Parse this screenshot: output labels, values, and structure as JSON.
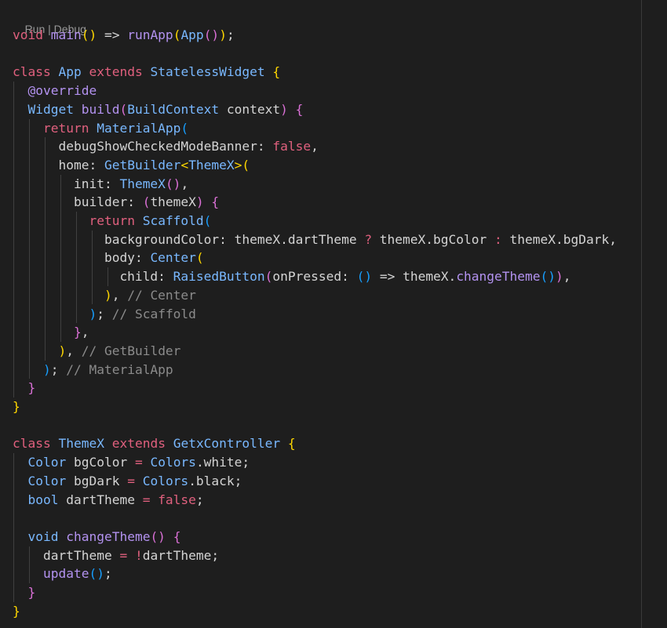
{
  "codelens": {
    "run": "Run",
    "separator": " | ",
    "debug": "Debug"
  },
  "colors": {
    "background": "#1e1e1e",
    "keyword": "#e0607e",
    "type": "#79b8ff",
    "function": "#b392f0",
    "text": "#d4d4d4",
    "comment": "#8b8b8b",
    "bracket_gold": "#ffd700",
    "bracket_orchid": "#da70d6",
    "bracket_blue": "#179fff"
  },
  "lines": [
    [
      [
        "void",
        "kw"
      ],
      [
        " ",
        "pl"
      ],
      [
        "main",
        "fn"
      ],
      [
        "()",
        "b1"
      ],
      [
        " => ",
        "op"
      ],
      [
        "runApp",
        "fn"
      ],
      [
        "(",
        "b1"
      ],
      [
        "App",
        "ty"
      ],
      [
        "()",
        "b2"
      ],
      [
        ")",
        "b1"
      ],
      [
        ";",
        "pl"
      ]
    ],
    [],
    [
      [
        "class",
        "kw"
      ],
      [
        " ",
        "pl"
      ],
      [
        "App",
        "ty"
      ],
      [
        " ",
        "pl"
      ],
      [
        "extends",
        "kw"
      ],
      [
        " ",
        "pl"
      ],
      [
        "StatelessWidget",
        "ty"
      ],
      [
        " ",
        "pl"
      ],
      [
        "{",
        "b1"
      ]
    ],
    [
      [
        "  ",
        "pl"
      ],
      [
        "@override",
        "fn"
      ]
    ],
    [
      [
        "  ",
        "pl"
      ],
      [
        "Widget",
        "ty"
      ],
      [
        " ",
        "pl"
      ],
      [
        "build",
        "fn"
      ],
      [
        "(",
        "b2"
      ],
      [
        "BuildContext",
        "ty"
      ],
      [
        " context",
        "pl"
      ],
      [
        ")",
        "b2"
      ],
      [
        " ",
        "pl"
      ],
      [
        "{",
        "b2"
      ]
    ],
    [
      [
        "    ",
        "pl"
      ],
      [
        "return",
        "kw"
      ],
      [
        " ",
        "pl"
      ],
      [
        "MaterialApp",
        "ty"
      ],
      [
        "(",
        "b3"
      ]
    ],
    [
      [
        "      debugShowCheckedModeBanner",
        "pl"
      ],
      [
        ": ",
        "pl"
      ],
      [
        "false",
        "kw"
      ],
      [
        ",",
        "pl"
      ]
    ],
    [
      [
        "      home",
        "pl"
      ],
      [
        ": ",
        "pl"
      ],
      [
        "GetBuilder",
        "ty"
      ],
      [
        "<",
        "b1"
      ],
      [
        "ThemeX",
        "ty"
      ],
      [
        ">",
        "b1"
      ],
      [
        "(",
        "b1"
      ]
    ],
    [
      [
        "        init",
        "pl"
      ],
      [
        ": ",
        "pl"
      ],
      [
        "ThemeX",
        "ty"
      ],
      [
        "()",
        "b2"
      ],
      [
        ",",
        "pl"
      ]
    ],
    [
      [
        "        builder",
        "pl"
      ],
      [
        ": ",
        "pl"
      ],
      [
        "(",
        "b2"
      ],
      [
        "themeX",
        "pl"
      ],
      [
        ")",
        "b2"
      ],
      [
        " ",
        "pl"
      ],
      [
        "{",
        "b2"
      ]
    ],
    [
      [
        "          ",
        "pl"
      ],
      [
        "return",
        "kw"
      ],
      [
        " ",
        "pl"
      ],
      [
        "Scaffold",
        "ty"
      ],
      [
        "(",
        "b3"
      ]
    ],
    [
      [
        "            backgroundColor",
        "pl"
      ],
      [
        ": themeX.dartTheme ",
        "pl"
      ],
      [
        "?",
        "kw"
      ],
      [
        " themeX.bgColor ",
        "pl"
      ],
      [
        ":",
        "kw"
      ],
      [
        " themeX.bgDark,",
        "pl"
      ]
    ],
    [
      [
        "            body",
        "pl"
      ],
      [
        ": ",
        "pl"
      ],
      [
        "Center",
        "ty"
      ],
      [
        "(",
        "b1"
      ]
    ],
    [
      [
        "              child",
        "pl"
      ],
      [
        ": ",
        "pl"
      ],
      [
        "RaisedButton",
        "ty"
      ],
      [
        "(",
        "b2"
      ],
      [
        "onPressed",
        "pl"
      ],
      [
        ": ",
        "pl"
      ],
      [
        "()",
        "b3"
      ],
      [
        " => ",
        "op"
      ],
      [
        "themeX.",
        "pl"
      ],
      [
        "changeTheme",
        "fn"
      ],
      [
        "()",
        "b3"
      ],
      [
        ")",
        "b2"
      ],
      [
        ",",
        "pl"
      ]
    ],
    [
      [
        "            ",
        "pl"
      ],
      [
        ")",
        "b1"
      ],
      [
        ", ",
        "pl"
      ],
      [
        "// Center",
        "cm"
      ]
    ],
    [
      [
        "          ",
        "pl"
      ],
      [
        ")",
        "b3"
      ],
      [
        "; ",
        "pl"
      ],
      [
        "// Scaffold",
        "cm"
      ]
    ],
    [
      [
        "        ",
        "pl"
      ],
      [
        "}",
        "b2"
      ],
      [
        ",",
        "pl"
      ]
    ],
    [
      [
        "      ",
        "pl"
      ],
      [
        ")",
        "b1"
      ],
      [
        ", ",
        "pl"
      ],
      [
        "// GetBuilder",
        "cm"
      ]
    ],
    [
      [
        "    ",
        "pl"
      ],
      [
        ")",
        "b3"
      ],
      [
        "; ",
        "pl"
      ],
      [
        "// MaterialApp",
        "cm"
      ]
    ],
    [
      [
        "  ",
        "pl"
      ],
      [
        "}",
        "b2"
      ]
    ],
    [
      [
        "}",
        "b1"
      ]
    ],
    [],
    [
      [
        "class",
        "kw"
      ],
      [
        " ",
        "pl"
      ],
      [
        "ThemeX",
        "ty"
      ],
      [
        " ",
        "pl"
      ],
      [
        "extends",
        "kw"
      ],
      [
        " ",
        "pl"
      ],
      [
        "GetxController",
        "ty"
      ],
      [
        " ",
        "pl"
      ],
      [
        "{",
        "b1"
      ]
    ],
    [
      [
        "  ",
        "pl"
      ],
      [
        "Color",
        "ty"
      ],
      [
        " bgColor ",
        "pl"
      ],
      [
        "=",
        "kw"
      ],
      [
        " ",
        "pl"
      ],
      [
        "Colors",
        "ty"
      ],
      [
        ".white;",
        "pl"
      ]
    ],
    [
      [
        "  ",
        "pl"
      ],
      [
        "Color",
        "ty"
      ],
      [
        " bgDark ",
        "pl"
      ],
      [
        "=",
        "kw"
      ],
      [
        " ",
        "pl"
      ],
      [
        "Colors",
        "ty"
      ],
      [
        ".black;",
        "pl"
      ]
    ],
    [
      [
        "  ",
        "pl"
      ],
      [
        "bool",
        "ty"
      ],
      [
        " dartTheme ",
        "pl"
      ],
      [
        "=",
        "kw"
      ],
      [
        " ",
        "pl"
      ],
      [
        "false",
        "kw"
      ],
      [
        ";",
        "pl"
      ]
    ],
    [],
    [
      [
        "  ",
        "pl"
      ],
      [
        "void",
        "ty"
      ],
      [
        " ",
        "pl"
      ],
      [
        "changeTheme",
        "fn"
      ],
      [
        "()",
        "b2"
      ],
      [
        " ",
        "pl"
      ],
      [
        "{",
        "b2"
      ]
    ],
    [
      [
        "    dartTheme ",
        "pl"
      ],
      [
        "=",
        "kw"
      ],
      [
        " ",
        "pl"
      ],
      [
        "!",
        "kw"
      ],
      [
        "dartTheme;",
        "pl"
      ]
    ],
    [
      [
        "    ",
        "pl"
      ],
      [
        "update",
        "fn"
      ],
      [
        "()",
        "b3"
      ],
      [
        ";",
        "pl"
      ]
    ],
    [
      [
        "  ",
        "pl"
      ],
      [
        "}",
        "b2"
      ]
    ],
    [
      [
        "}",
        "b1"
      ]
    ]
  ]
}
